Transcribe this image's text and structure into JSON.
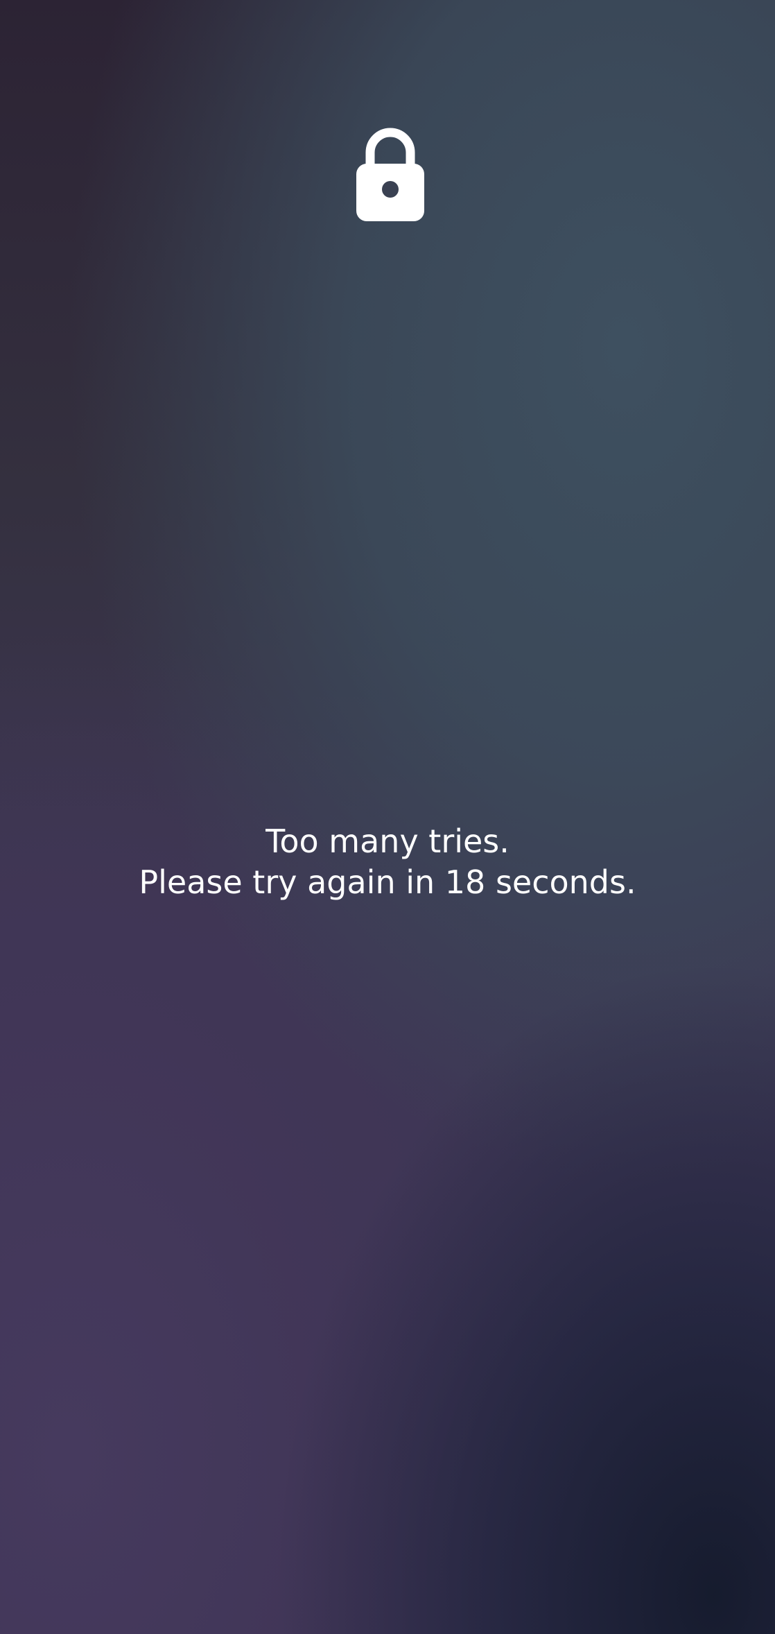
{
  "lockscreen": {
    "icon": "lock-icon",
    "message_line_1": "Too many tries.",
    "message_line_2": "Please try again in 18 seconds."
  },
  "colors": {
    "text": "#ffffff",
    "icon": "#ffffff"
  }
}
